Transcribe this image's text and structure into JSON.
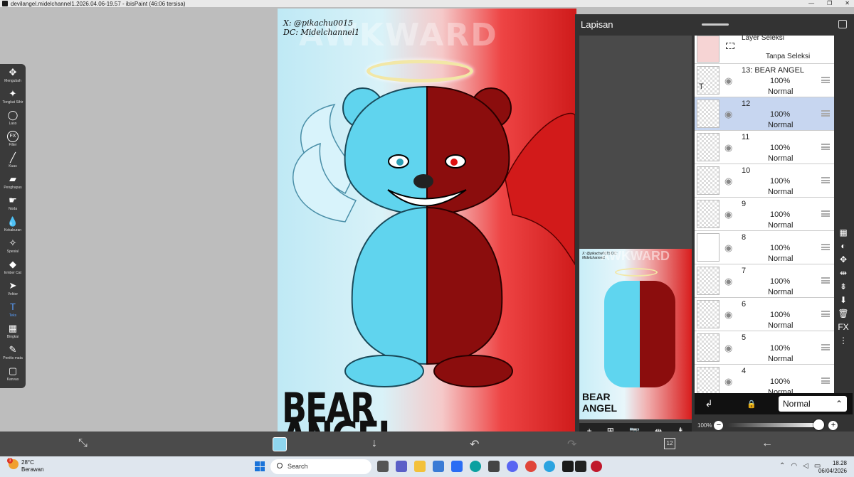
{
  "window": {
    "title": "devilangel.midelchannel1.2026.04.06-19.57 - ibisPaint (46:06 tersisa)",
    "min": "—",
    "max": "❐",
    "close": "✕"
  },
  "toolbar": {
    "tools": [
      {
        "icon": "move-icon",
        "glyph": "✥",
        "label": "Mengubah"
      },
      {
        "icon": "magic-wand-icon",
        "glyph": "✦",
        "label": "Tongkat Sihir"
      },
      {
        "icon": "lasso-icon",
        "glyph": "◯",
        "label": "Laso"
      },
      {
        "icon": "filter-icon",
        "glyph": "FX",
        "label": "Filter"
      },
      {
        "icon": "brush-icon",
        "glyph": "╱",
        "label": "Kuas"
      },
      {
        "icon": "eraser-icon",
        "glyph": "▰",
        "label": "Penghapus"
      },
      {
        "icon": "smudge-icon",
        "glyph": "☛",
        "label": "Noda"
      },
      {
        "icon": "blur-icon",
        "glyph": "💧",
        "label": "Kekaburan"
      },
      {
        "icon": "special-icon",
        "glyph": "✧",
        "label": "Spesial"
      },
      {
        "icon": "fill-bucket-icon",
        "glyph": "◆",
        "label": "Ember Cat"
      },
      {
        "icon": "select-icon",
        "glyph": "➤",
        "label": "Vektor"
      },
      {
        "icon": "text-icon",
        "glyph": "T",
        "label": "Teks"
      },
      {
        "icon": "frame-icon",
        "glyph": "▦",
        "label": "Bingkai"
      },
      {
        "icon": "eyedropper-icon",
        "glyph": "✎",
        "label": "Penitis mata"
      },
      {
        "icon": "canvas-icon",
        "glyph": "▢",
        "label": "Kanvas"
      }
    ],
    "active_tool": "Teks"
  },
  "canvas": {
    "credit_line1": "X: @pikachu0015",
    "credit_line2": "DC: Midelchannel1",
    "watermark": "AWKWARD",
    "title_line1": "BEAR",
    "title_line2": "ANGEL"
  },
  "layers_panel": {
    "title": "Lapisan",
    "selection_layer": {
      "name": "Layer Seleksi",
      "status": "Tanpa Seleksi"
    },
    "layers": [
      {
        "name": "13: BEAR ANGEL",
        "opacity": "100%",
        "mode": "Normal",
        "selected": false,
        "thumb": "T"
      },
      {
        "name": "12",
        "opacity": "100%",
        "mode": "Normal",
        "selected": true,
        "thumb": ""
      },
      {
        "name": "11",
        "opacity": "100%",
        "mode": "Normal",
        "selected": false,
        "thumb": ""
      },
      {
        "name": "10",
        "opacity": "100%",
        "mode": "Normal",
        "selected": false,
        "thumb": ""
      },
      {
        "name": "9",
        "opacity": "100%",
        "mode": "Normal",
        "selected": false,
        "thumb": ""
      },
      {
        "name": "8",
        "opacity": "100%",
        "mode": "Normal",
        "selected": false,
        "thumb": ""
      },
      {
        "name": "7",
        "opacity": "100%",
        "mode": "Normal",
        "selected": false,
        "thumb": ""
      },
      {
        "name": "6",
        "opacity": "100%",
        "mode": "Normal",
        "selected": false,
        "thumb": ""
      },
      {
        "name": "5",
        "opacity": "100%",
        "mode": "Normal",
        "selected": false,
        "thumb": ""
      },
      {
        "name": "4",
        "opacity": "100%",
        "mode": "Normal",
        "selected": false,
        "thumb": ""
      }
    ],
    "preview_title_1": "BEAR",
    "preview_title_2": "ANGEL",
    "preview_credit": "X: @pikachu0015 DC: Midelchannel1",
    "preview_watermark": "AWKWARD",
    "preview_tools": [
      "+",
      "⊞",
      "📷",
      "⇹",
      "⇟"
    ],
    "side_tools": [
      "▦",
      "◐",
      "✥",
      "⇹",
      "⇟",
      "⬇",
      "🗑",
      "FX",
      "⋮"
    ],
    "blend_mode": "Normal",
    "blend_caret": "⌃",
    "clip_icon": "↲",
    "lock_icon": "🔒",
    "opacity_label": "100%",
    "opacity_value": 1.0,
    "minus": "−",
    "plus": "+"
  },
  "appbar": {
    "transform_glyph": "⤡",
    "download_glyph": "↓",
    "undo_glyph": "↶",
    "redo_glyph": "↷",
    "layer_count": "12",
    "back_glyph": "←"
  },
  "taskbar": {
    "temperature": "28°C",
    "weather": "Berawan",
    "weather_badge": "1",
    "search_placeholder": "Search",
    "time": "18.28",
    "date": "06/04/2026",
    "tray_caret": "⌃"
  },
  "colors": {
    "accent": "#5aa0ff",
    "selected_layer": "#c7d6f0",
    "primary_color_swatch": "#8fd6ef"
  }
}
